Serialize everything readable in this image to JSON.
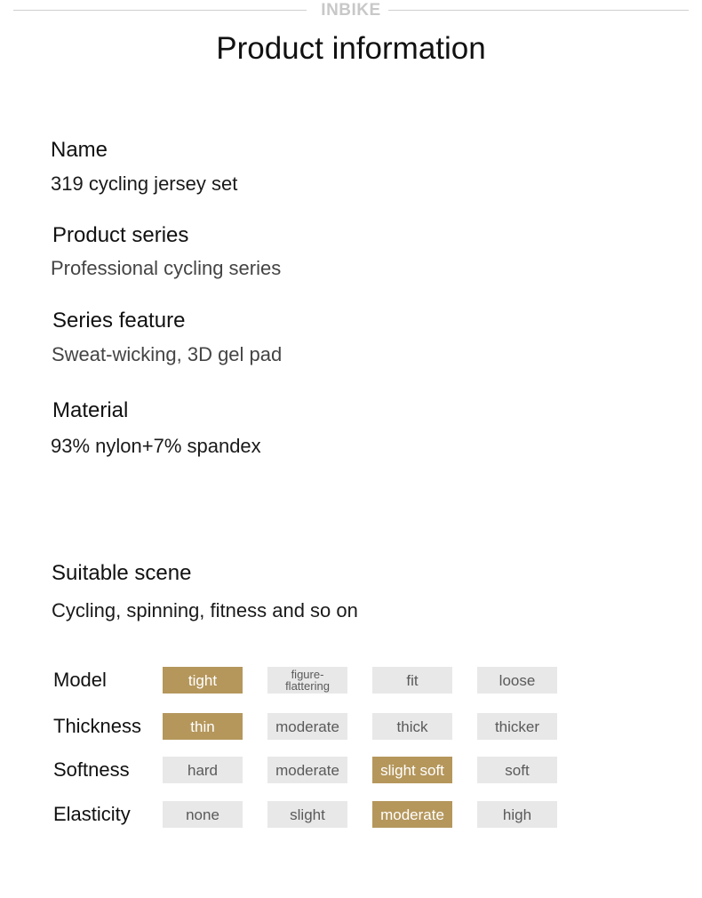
{
  "header": {
    "brand": "INBIKE",
    "title": "Product information"
  },
  "info": [
    {
      "label": "Name",
      "value": "319 cycling jersey set"
    },
    {
      "label": "Product series",
      "value": "Professional cycling series"
    },
    {
      "label": "Series feature",
      "value": "Sweat-wicking, 3D gel pad"
    },
    {
      "label": "Material",
      "value": "93% nylon+7% spandex"
    },
    {
      "label": "Suitable scene",
      "value": "Cycling, spinning, fitness and so on"
    }
  ],
  "attributes": [
    {
      "label": "Model",
      "options": [
        "tight",
        "figure-\nflattering",
        "fit",
        "loose"
      ],
      "selected": "tight"
    },
    {
      "label": "Thickness",
      "options": [
        "thin",
        "moderate",
        "thick",
        "thicker"
      ],
      "selected": "thin"
    },
    {
      "label": "Softness",
      "options": [
        "hard",
        "moderate",
        "slight soft",
        "soft"
      ],
      "selected": "slight soft"
    },
    {
      "label": "Elasticity",
      "options": [
        "none",
        "slight",
        "moderate",
        "high"
      ],
      "selected": "moderate"
    }
  ],
  "colors": {
    "selected": "#b5975c",
    "unselected": "#e8e8e8"
  }
}
